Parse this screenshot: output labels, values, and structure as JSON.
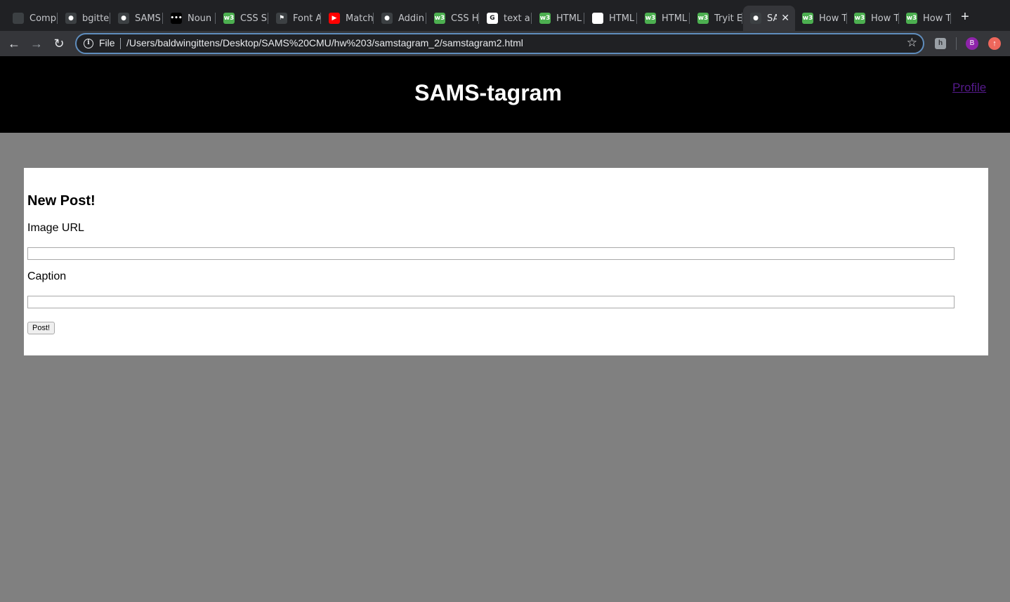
{
  "browser": {
    "tabs": [
      {
        "title": "Comp",
        "icon": "generic-favicon-icon",
        "color": "#3c4043"
      },
      {
        "title": "bgitte",
        "icon": "github-icon",
        "color": "#3c4043"
      },
      {
        "title": "SAMS",
        "icon": "github-icon",
        "color": "#3c4043"
      },
      {
        "title": "Noun",
        "icon": "noun-project-icon",
        "color": "#000000"
      },
      {
        "title": "CSS S",
        "icon": "w3schools-icon",
        "color": "#4caf50"
      },
      {
        "title": "Font A",
        "icon": "font-awesome-icon",
        "color": "#3c4043"
      },
      {
        "title": "Match",
        "icon": "youtube-icon",
        "color": "#ff0000"
      },
      {
        "title": "Addin",
        "icon": "github-icon",
        "color": "#3c4043"
      },
      {
        "title": "CSS H",
        "icon": "w3schools-icon",
        "color": "#4caf50"
      },
      {
        "title": "text al",
        "icon": "google-icon",
        "color": "#ffffff"
      },
      {
        "title": "HTML",
        "icon": "w3schools-icon",
        "color": "#4caf50"
      },
      {
        "title": "HTML",
        "icon": "generic-favicon-icon",
        "color": "#ffffff"
      },
      {
        "title": "HTML",
        "icon": "w3schools-icon",
        "color": "#4caf50"
      },
      {
        "title": "Tryit E",
        "icon": "w3schools-icon",
        "color": "#4caf50"
      },
      {
        "title": "SA",
        "icon": "github-icon",
        "color": "#3c4043",
        "active": true
      },
      {
        "title": "How T",
        "icon": "w3schools-icon",
        "color": "#4caf50"
      },
      {
        "title": "How T",
        "icon": "w3schools-icon",
        "color": "#4caf50"
      },
      {
        "title": "How T",
        "icon": "w3schools-icon",
        "color": "#4caf50"
      }
    ],
    "address": {
      "scheme_label": "File",
      "url": "/Users/baldwingittens/Desktop/SAMS%20CMU/hw%203/samstagram_2/samstagram2.html"
    },
    "avatar_letter": "B"
  },
  "site": {
    "title": "SAMS-tagram",
    "profile_link": "Profile"
  },
  "form": {
    "heading": "New Post!",
    "image_url_label": "Image URL",
    "image_url_value": "",
    "caption_label": "Caption",
    "caption_value": "",
    "submit_label": "Post!"
  }
}
